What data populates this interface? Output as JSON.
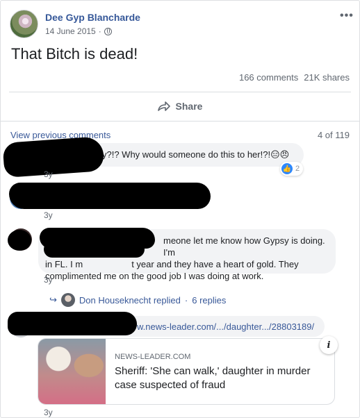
{
  "post": {
    "author": "Dee Gyp Blancharde",
    "date": "14 June 2015",
    "separator": "·",
    "privacy_icon": "globe-icon",
    "more_icon": "•••",
    "text": "That Bitch is dead!",
    "comments_count": "166 comments",
    "shares_count": "21K shares",
    "share_label": "Share"
  },
  "comments_header": {
    "view_previous": "View previous comments",
    "count": "4 of 119"
  },
  "comments": [
    {
      "text": "y?!? Why would someone do this to her!?!😑😠",
      "reaction_count": "2",
      "age": "3y"
    },
    {
      "age": "3y"
    },
    {
      "text_line1": "meone let me know how Gypsy is doing. I'm",
      "text_line2_a": "in FL. I m",
      "text_line2_b": "t year and they have a heart of gold. They",
      "text_line3": "complimented me on the good job I was doing at work.",
      "age": "3y",
      "reply": {
        "name": "Don Houseknecht replied",
        "sep": "·",
        "count": "6 replies"
      }
    },
    {
      "link_text": "w.news-leader.com/.../daughter.../28803189/",
      "age": "3y",
      "preview": {
        "source": "NEWS-LEADER.COM",
        "title": "Sheriff: 'She can walk,' daughter in murder case suspected of fraud",
        "info_icon": "i"
      }
    }
  ],
  "colors": {
    "link": "#385898",
    "author": "#365899",
    "bubble": "#f2f3f5",
    "like": "#2d88ff"
  }
}
